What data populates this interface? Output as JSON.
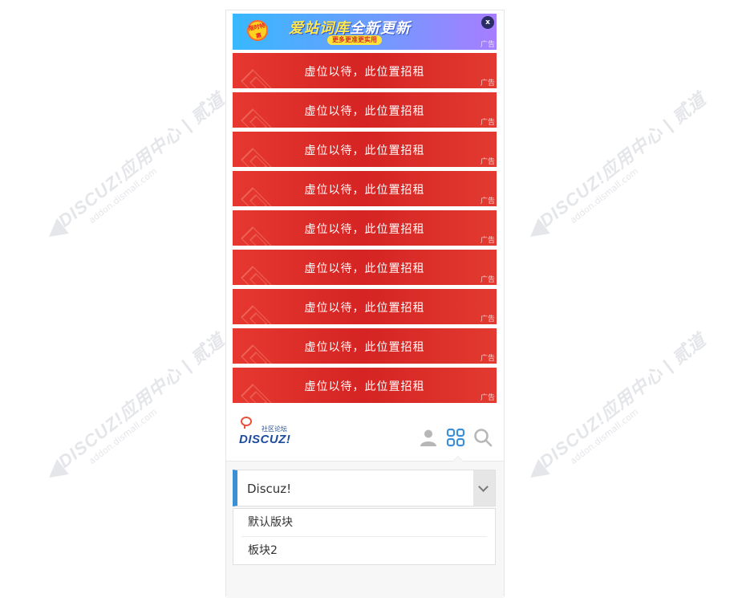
{
  "top_banner": {
    "badge_text": "限时特惠",
    "headline_a": "爱站词库",
    "headline_b": "全新更新",
    "subline": "更多更准更实用",
    "close_label": "x",
    "ad_tag": "广告"
  },
  "red_ads": [
    {
      "text": "虚位以待，此位置招租",
      "ad_tag": "广告"
    },
    {
      "text": "虚位以待，此位置招租",
      "ad_tag": "广告"
    },
    {
      "text": "虚位以待，此位置招租",
      "ad_tag": "广告"
    },
    {
      "text": "虚位以待，此位置招租",
      "ad_tag": "广告"
    },
    {
      "text": "虚位以待，此位置招租",
      "ad_tag": "广告"
    },
    {
      "text": "虚位以待，此位置招租",
      "ad_tag": "广告"
    },
    {
      "text": "虚位以待，此位置招租",
      "ad_tag": "广告"
    },
    {
      "text": "虚位以待，此位置招租",
      "ad_tag": "广告"
    },
    {
      "text": "虚位以待，此位置招租",
      "ad_tag": "广告"
    }
  ],
  "logo": {
    "forum_cn": "社区论坛",
    "brand": "DISCUZ!"
  },
  "header_icons": [
    "user-icon",
    "apps-grid-icon",
    "search-icon"
  ],
  "forum_select": {
    "selected": "Discuz!"
  },
  "sub_forums": [
    {
      "label": "默认版块"
    },
    {
      "label": "板块2"
    }
  ],
  "watermark": {
    "logo": "DISCUZ!应用中心 | 贰道",
    "sub": "addon.dismall.com"
  },
  "colors": {
    "ad_red": "#d52423",
    "accent_blue": "#3b8fd6",
    "brand_blue": "#1e4da0"
  }
}
